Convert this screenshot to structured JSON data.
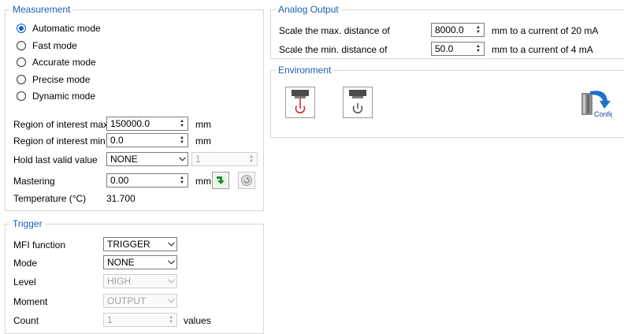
{
  "measurement": {
    "title": "Measurement",
    "modes": [
      {
        "label": "Automatic mode",
        "checked": true
      },
      {
        "label": "Fast mode",
        "checked": false
      },
      {
        "label": "Accurate mode",
        "checked": false
      },
      {
        "label": "Precise mode",
        "checked": false
      },
      {
        "label": "Dynamic mode",
        "checked": false
      }
    ],
    "roi_max": {
      "label": "Region of interest max",
      "value": "150000.0",
      "unit": "mm"
    },
    "roi_min": {
      "label": "Region of interest min",
      "value": "0.0",
      "unit": "mm"
    },
    "hold": {
      "label": "Hold last valid value",
      "select": "NONE",
      "count": "1"
    },
    "mastering": {
      "label": "Mastering",
      "value": "0.00",
      "unit": "mm"
    },
    "temperature": {
      "label": "Temperature (°C)",
      "value": "31.700"
    }
  },
  "trigger": {
    "title": "Trigger",
    "mfi": {
      "label": "MFI function",
      "value": "TRIGGER"
    },
    "mode": {
      "label": "Mode",
      "value": "NONE"
    },
    "level": {
      "label": "Level",
      "value": "HIGH"
    },
    "moment": {
      "label": "Moment",
      "value": "OUTPUT"
    },
    "count": {
      "label": "Count",
      "value": "1",
      "unit": "values"
    }
  },
  "analog": {
    "title": "Analog Output",
    "max": {
      "label": "Scale the max. distance of",
      "value": "8000.0",
      "suffix": "mm to a current of  20 mA"
    },
    "min": {
      "label": "Scale the min. distance of",
      "value": "50.0",
      "suffix": "mm to a current of  4 mA"
    }
  },
  "environment": {
    "title": "Environment",
    "config_label": "Config"
  },
  "colors": {
    "accent": "#1a5fb4",
    "radio": "#0b5cd6",
    "power_red": "#d9262b",
    "green": "#1e8a2e"
  }
}
